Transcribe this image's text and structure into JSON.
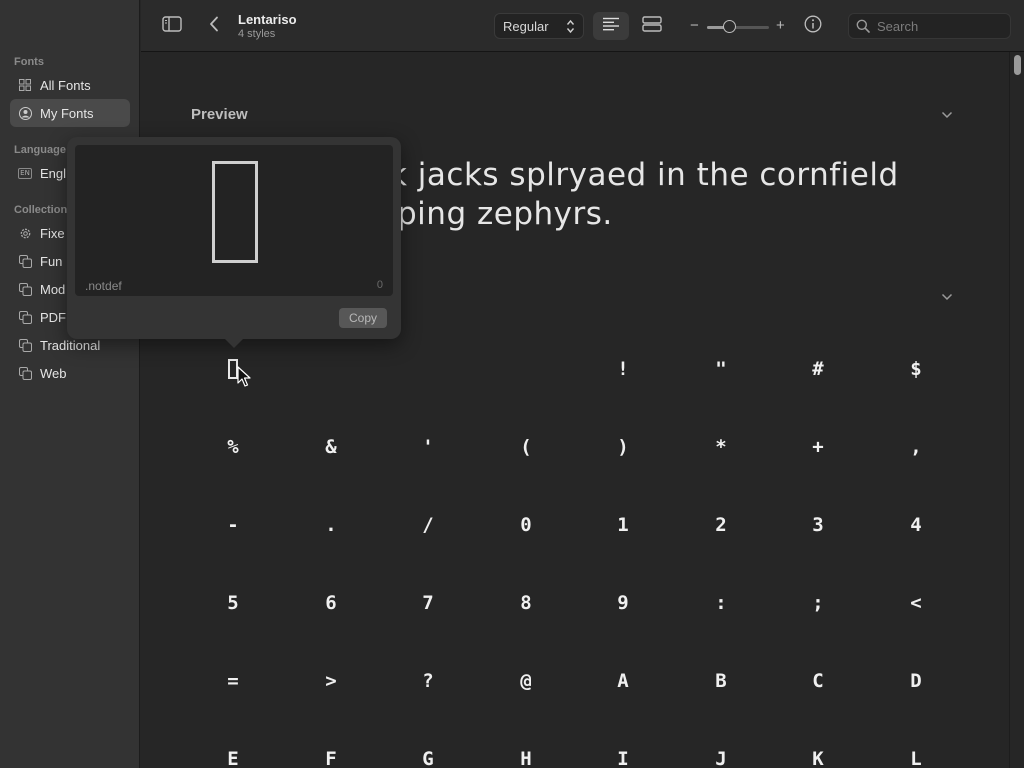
{
  "sidebar": {
    "fonts_heading": "Fonts",
    "fonts_items": [
      {
        "label": "All Fonts",
        "icon": "grid-icon"
      },
      {
        "label": "My Fonts",
        "icon": "person-circle-icon"
      }
    ],
    "language_heading": "Language",
    "language_item": {
      "badge": "EN",
      "label": "Engl"
    },
    "collections_heading": "Collection",
    "collection_items": [
      {
        "label": "Fixe",
        "icon": "gear-icon"
      },
      {
        "label": "Fun",
        "icon": "copy-icon"
      },
      {
        "label": "Mod",
        "icon": "copy-icon"
      },
      {
        "label": "PDF",
        "icon": "copy-icon"
      },
      {
        "label": "Traditional",
        "icon": "copy-icon"
      },
      {
        "label": "Web",
        "icon": "copy-icon"
      }
    ]
  },
  "toolbar": {
    "font_name": "Lentariso",
    "font_styles": "4 styles",
    "style_value": "Regular",
    "zoom_minus": "−",
    "zoom_plus": "+",
    "zoom_level": 0.35,
    "search_placeholder": "Search"
  },
  "main": {
    "preview_title": "Preview",
    "preview_line1": "k jacks splryaed in the cornfield",
    "preview_line2": "ping zephyrs.",
    "glyph_rows": [
      [
        "",
        "",
        " ",
        "!",
        "\"",
        "#",
        "$"
      ],
      [
        "%",
        "&",
        "'",
        "(",
        ")",
        "*",
        "+",
        ","
      ],
      [
        "-",
        ".",
        "/",
        "0",
        "1",
        "2",
        "3",
        "4"
      ],
      [
        "5",
        "6",
        "7",
        "8",
        "9",
        ":",
        ";",
        "<"
      ],
      [
        "=",
        ">",
        "?",
        "@",
        "A",
        "B",
        "C",
        "D"
      ],
      [
        "E",
        "F",
        "G",
        "H",
        "I",
        "J",
        "K",
        "L"
      ]
    ]
  },
  "popover": {
    "glyph_name": ".notdef",
    "glyph_code": "0",
    "copy_label": "Copy"
  }
}
